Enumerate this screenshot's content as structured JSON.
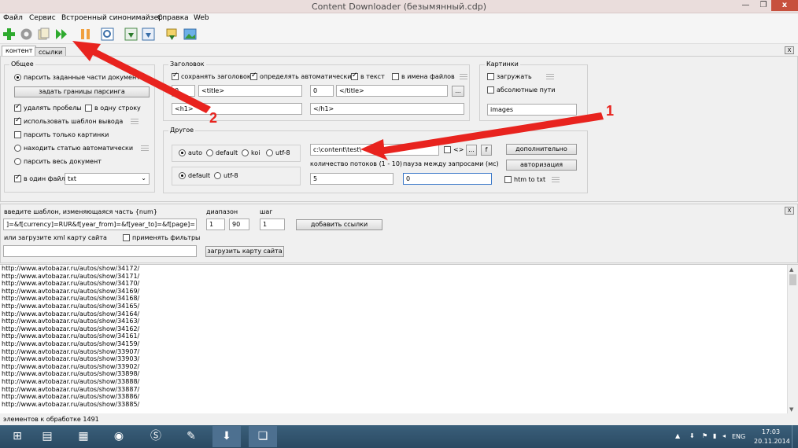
{
  "window": {
    "title": "Content Downloader (безымянный.cdp)",
    "close": "x",
    "min": "—",
    "max": "❐"
  },
  "menu": [
    "Файл",
    "Сервис",
    "Встроенный синонимайзер",
    "Справка",
    "Web"
  ],
  "tabs": [
    "контент",
    "ссылки"
  ],
  "panel_close": "X",
  "general": {
    "title": "Общее",
    "parse_parts": "парсить заданные части документа",
    "set_bounds": "задать границы парсинга",
    "remove_spaces": "удалять пробелы",
    "one_line": "в одну строку",
    "use_template": "использовать шаблон вывода",
    "only_images": "парсить только картинки",
    "find_article": "находить статью автоматически",
    "whole_doc": "парсить весь документ",
    "one_file": "в один файл",
    "file_ext": "txt"
  },
  "headers": {
    "title": "Заголовок",
    "save_title": "сохранять заголовок",
    "auto_detect": "определять автоматически",
    "in_text": "в текст",
    "in_filenames": "в имена файлов",
    "f1": "0",
    "f2": "<title>",
    "f3": "0",
    "f4": "</title>",
    "f5": "<h1>",
    "f6": "</h1>",
    "dots": "..."
  },
  "images": {
    "title": "Картинки",
    "load": "загружать",
    "abs_paths": "абсолютные пути",
    "folder": "images"
  },
  "other": {
    "title": "Другое",
    "enc": [
      "auto",
      "default",
      "koi",
      "utf-8"
    ],
    "enc2": [
      "default",
      "utf-8"
    ],
    "path": "c:\\content\\test\\",
    "brackets": "<>",
    "dots": "...",
    "f": "f",
    "threads_label": "количество потоков (1 - 10)",
    "threads": "5",
    "pause_label": "пауза между запросами (мс)",
    "pause": "0",
    "more": "дополнительно",
    "auth": "авторизация",
    "htm_to_txt": "htm to txt"
  },
  "links": {
    "template_label": "введите шаблон, изменяющаяся часть {num}",
    "template": "]=&f[currency]=RUR&f[year_from]=&f[year_to]=&f[page]={num}",
    "range_label": "диапазон",
    "range_from": "1",
    "range_to": "90",
    "step_label": "шаг",
    "step": "1",
    "add_links": "добавить ссылки",
    "xml_label": "или загрузите xml карту сайта",
    "apply_filters": "применять фильтры",
    "load_sitemap": "загрузить карту сайта",
    "close": "X"
  },
  "urls": [
    "http://www.avtobazar.ru/autos/show/34172/",
    "http://www.avtobazar.ru/autos/show/34171/",
    "http://www.avtobazar.ru/autos/show/34170/",
    "http://www.avtobazar.ru/autos/show/34169/",
    "http://www.avtobazar.ru/autos/show/34168/",
    "http://www.avtobazar.ru/autos/show/34165/",
    "http://www.avtobazar.ru/autos/show/34164/",
    "http://www.avtobazar.ru/autos/show/34163/",
    "http://www.avtobazar.ru/autos/show/34162/",
    "http://www.avtobazar.ru/autos/show/34161/",
    "http://www.avtobazar.ru/autos/show/34159/",
    "http://www.avtobazar.ru/autos/show/33907/",
    "http://www.avtobazar.ru/autos/show/33903/",
    "http://www.avtobazar.ru/autos/show/33902/",
    "http://www.avtobazar.ru/autos/show/33898/",
    "http://www.avtobazar.ru/autos/show/33888/",
    "http://www.avtobazar.ru/autos/show/33887/",
    "http://www.avtobazar.ru/autos/show/33886/",
    "http://www.avtobazar.ru/autos/show/33885/"
  ],
  "status": "элементов к обработке 1491",
  "annotations": {
    "a1": "1",
    "a2": "2"
  },
  "tray": {
    "lang": "ENG",
    "time": "17:03",
    "date": "20.11.2014"
  },
  "colors": {
    "arrow": "#e8231e",
    "title_bg": "#eadddc",
    "taskbar": "#2b4a63"
  }
}
